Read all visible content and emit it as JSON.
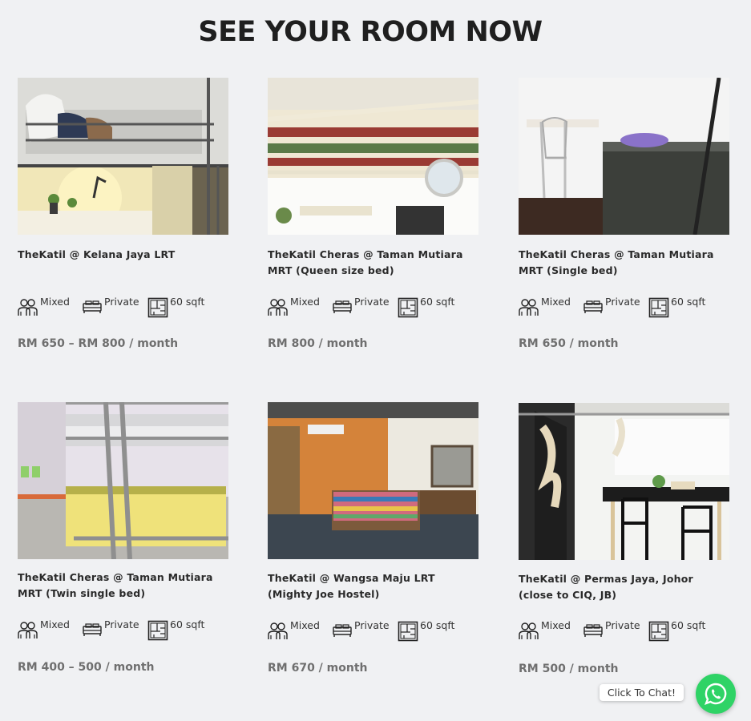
{
  "title": "SEE YOUR ROOM NOW",
  "rooms": [
    {
      "name": "TheKatil @ Kelana Jaya LRT",
      "gender": "Mixed",
      "type": "Private",
      "size": "60 sqft",
      "price": "RM 650 – RM 800 / month"
    },
    {
      "name": "TheKatil Cheras @ Taman Mutiara MRT (Queen size bed)",
      "gender": "Mixed",
      "type": "Private",
      "size": "60 sqft",
      "price": "RM 800 / month"
    },
    {
      "name": "TheKatil Cheras @ Taman Mutiara MRT (Single bed)",
      "gender": "Mixed",
      "type": "Private",
      "size": "60 sqft",
      "price": "RM 650 / month"
    },
    {
      "name": "TheKatil Cheras @ Taman Mutiara MRT (Twin single bed)",
      "gender": "Mixed",
      "type": "Private",
      "size": "60 sqft",
      "price": "RM 400 – 500 / month"
    },
    {
      "name": "TheKatil @ Wangsa Maju LRT (Mighty Joe Hostel)",
      "gender": "Mixed",
      "type": "Private",
      "size": "60 sqft",
      "price": "RM 670 / month"
    },
    {
      "name": "TheKatil @ Permas Jaya, Johor (close to CIQ, JB)",
      "gender": "Mixed",
      "type": "Private",
      "size": "60 sqft",
      "price": "RM 500 / month"
    }
  ],
  "chat": {
    "label": "Click To Chat!",
    "color": "#2fd366"
  },
  "icons": {
    "gender": "people-icon",
    "type": "bed-icon",
    "size": "floorplan-icon",
    "chat": "whatsapp-icon"
  }
}
